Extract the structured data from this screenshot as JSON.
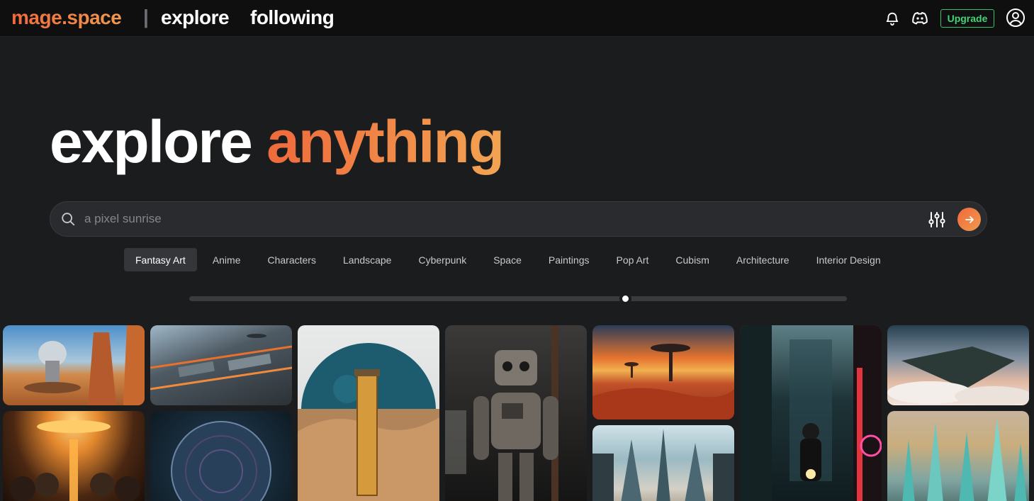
{
  "header": {
    "brand": "mage.space",
    "separator": "|",
    "nav_explore": "explore",
    "nav_following": "following",
    "upgrade_label": "Upgrade",
    "icons": [
      "bell-icon",
      "discord-icon",
      "user-circle-icon"
    ]
  },
  "hero": {
    "title_part1": "explore",
    "title_part2": "anything"
  },
  "search": {
    "placeholder": "a pixel sunrise",
    "icons": [
      "search-icon",
      "filter-sliders-icon",
      "arrow-right-icon"
    ]
  },
  "categories": [
    {
      "label": "Fantasy Art",
      "active": true
    },
    {
      "label": "Anime",
      "active": false
    },
    {
      "label": "Characters",
      "active": false
    },
    {
      "label": "Landscape",
      "active": false
    },
    {
      "label": "Cyberpunk",
      "active": false
    },
    {
      "label": "Space",
      "active": false
    },
    {
      "label": "Paintings",
      "active": false
    },
    {
      "label": "Pop Art",
      "active": false
    },
    {
      "label": "Cubism",
      "active": false
    },
    {
      "label": "Architecture",
      "active": false
    },
    {
      "label": "Interior Design",
      "active": false
    }
  ],
  "slider": {
    "value_fraction": 0.66
  },
  "gallery": [
    {
      "subject": "desert dome structure with arch"
    },
    {
      "subject": "futuristic circuit city with spaceships"
    },
    {
      "subject": "lighthouse tower before blue planet"
    },
    {
      "subject": "rusty robot in industrial hall"
    },
    {
      "subject": "alien desert with mushroom towers at sunset"
    },
    {
      "subject": "motorcycle rider in neon city"
    },
    {
      "subject": "floating island above clouds"
    },
    {
      "subject": "helmeted figures under glowing ring"
    },
    {
      "subject": "ornate glass sphere"
    },
    {
      "subject": "sci-fi spire city"
    },
    {
      "subject": "crystal spire city"
    }
  ],
  "colors": {
    "accent_start": "#ef6a3c",
    "accent_end": "#f19a4d",
    "upgrade_green": "#45d277",
    "background": "#1b1c1e"
  }
}
